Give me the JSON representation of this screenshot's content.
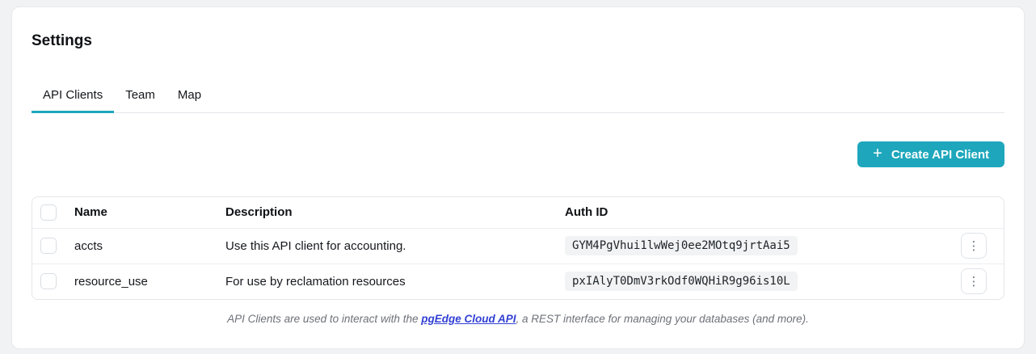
{
  "page": {
    "title": "Settings",
    "background_color": "#f1f2f4",
    "accent_color": "#1ea7bc",
    "link_color": "#3240d4"
  },
  "tabs": [
    {
      "label": "API Clients",
      "active": true
    },
    {
      "label": "Team",
      "active": false
    },
    {
      "label": "Map",
      "active": false
    }
  ],
  "icons": {
    "plus": "+",
    "kebab": "⋮"
  },
  "toolbar": {
    "create_button_label": "Create API Client"
  },
  "table": {
    "columns": {
      "name": "Name",
      "description": "Description",
      "auth_id": "Auth ID"
    },
    "rows": [
      {
        "name": "accts",
        "description": "Use this API client for accounting.",
        "auth_id": "GYM4PgVhui1lwWej0ee2MOtq9jrtAai5"
      },
      {
        "name": "resource_use",
        "description": "For use by reclamation resources",
        "auth_id": "pxIAlyT0DmV3rkOdf0WQHiR9g96is10L"
      }
    ]
  },
  "footer": {
    "text_before": "API Clients are used to interact with the ",
    "link_label": "pgEdge Cloud API",
    "text_after": ", a REST interface for managing your databases (and more)."
  }
}
